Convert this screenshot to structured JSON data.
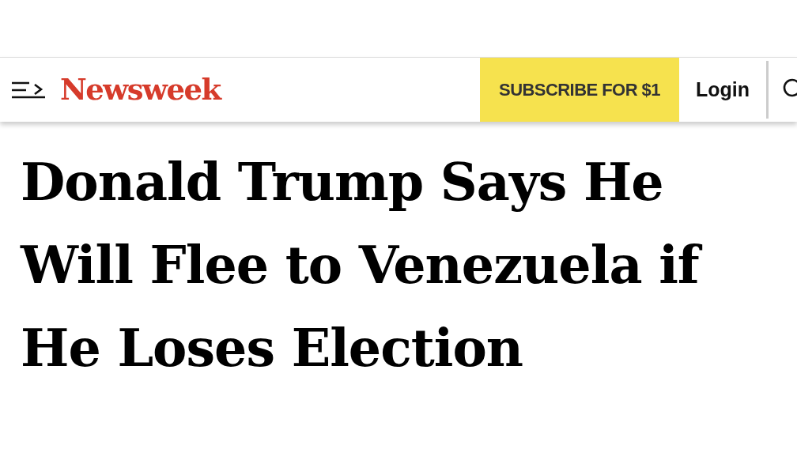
{
  "header": {
    "logo": "Newsweek",
    "subscribe_button": "SUBSCRIBE FOR $1",
    "login_link": "Login"
  },
  "article": {
    "headline": "Donald Trump Says He Will Flee to Venezuela if He Loses Election"
  }
}
